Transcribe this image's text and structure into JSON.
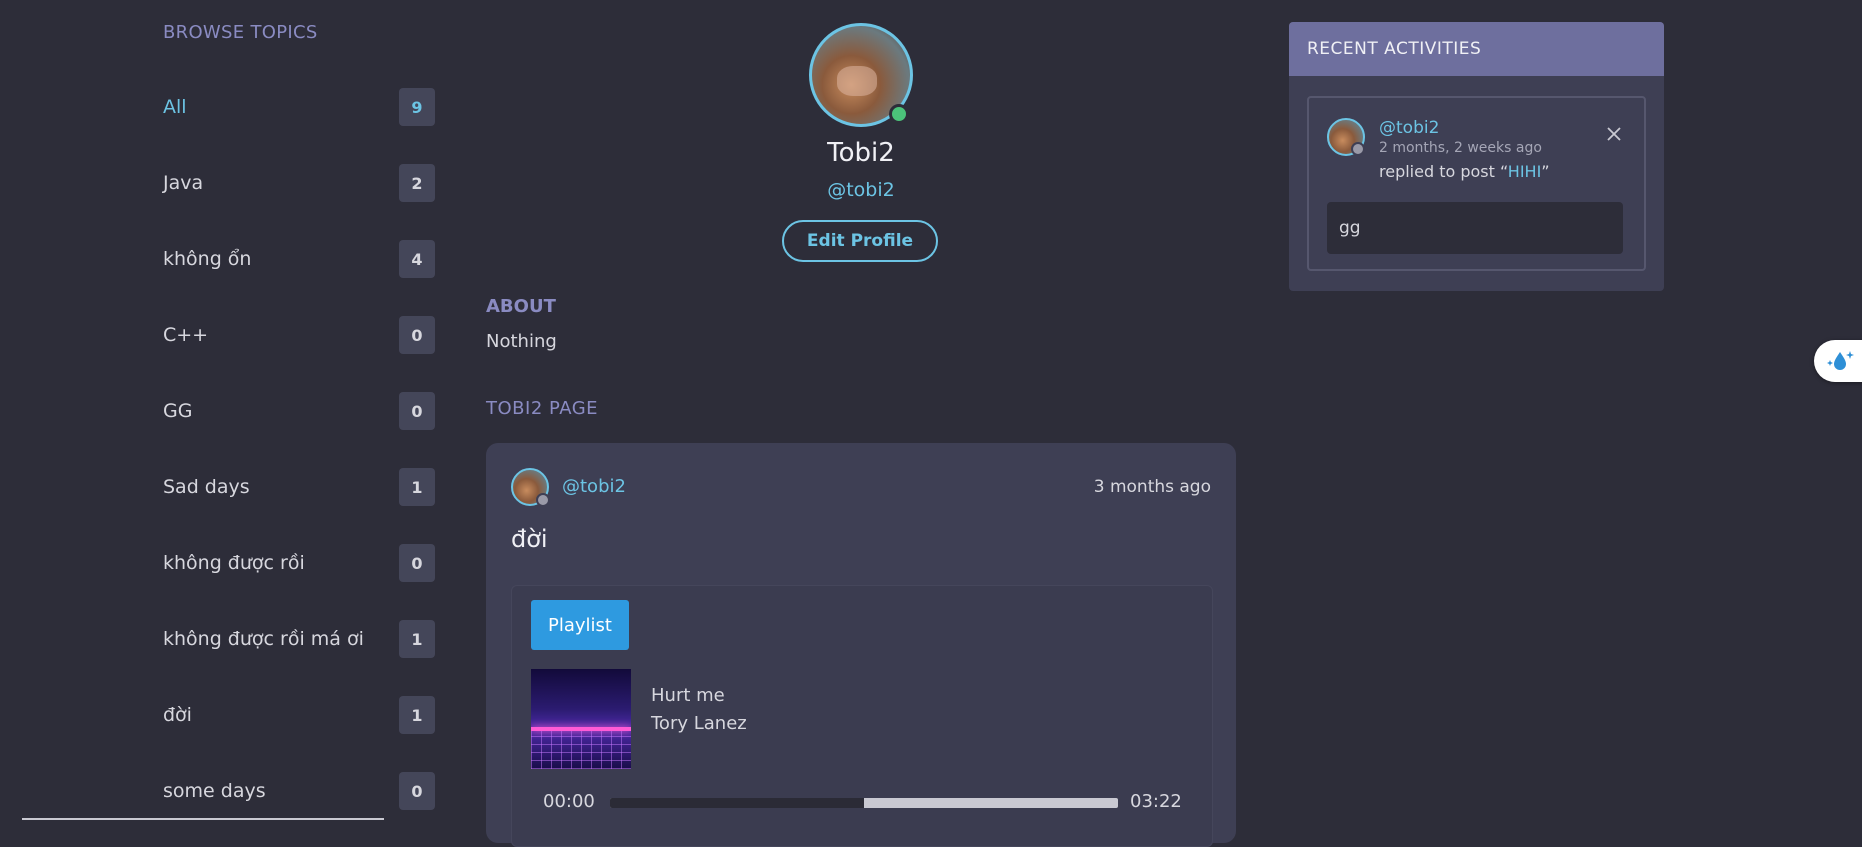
{
  "sidebar": {
    "title": "BROWSE TOPICS",
    "topics": [
      {
        "label": "All",
        "count": "9"
      },
      {
        "label": "Java",
        "count": "2"
      },
      {
        "label": "không ổn",
        "count": "4"
      },
      {
        "label": "C++",
        "count": "0"
      },
      {
        "label": "GG",
        "count": "0"
      },
      {
        "label": "Sad days",
        "count": "1"
      },
      {
        "label": "không được rồi",
        "count": "0"
      },
      {
        "label": "không được rồi má ơi",
        "count": "1"
      },
      {
        "label": "đời",
        "count": "1"
      },
      {
        "label": "some days",
        "count": "0"
      }
    ]
  },
  "profile": {
    "name": "Tobi2",
    "handle": "@tobi2",
    "edit_label": "Edit Profile",
    "about_title": "ABOUT",
    "about_text": "Nothing",
    "page_title": "TOBI2 PAGE"
  },
  "post": {
    "handle": "@tobi2",
    "time": "3 months ago",
    "title": "đời",
    "player": {
      "playlist_label": "Playlist",
      "track_title": "Hurt me",
      "track_artist": "Tory Lanez",
      "current_time": "00:00",
      "total_time": "03:22",
      "progress_fraction": 0.5
    }
  },
  "activities": {
    "title": "RECENT ACTIVITIES",
    "items": [
      {
        "handle": "@tobi2",
        "time": "2 months, 2 weeks ago",
        "text_prefix": "replied to post “",
        "post_link": "HIHI",
        "text_suffix": "”",
        "reply": "gg"
      }
    ]
  },
  "colors": {
    "background": "#2d2d39",
    "accent": "#6cc4e4",
    "section_title": "#8a8bc2",
    "card": "#3e3f54",
    "header_bar": "#6e6f9e",
    "online": "#4bc27a",
    "playlist_button": "#2e9ae0"
  },
  "icons": {
    "close": "close-icon",
    "floating_widget": "droplet-sparkle-icon"
  }
}
